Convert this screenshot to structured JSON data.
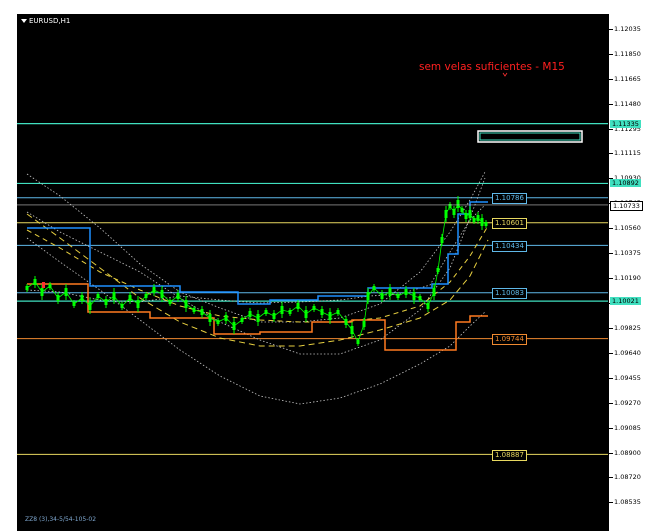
{
  "chart_window": {
    "title": "EURUSD,H1",
    "warning": "sem velas suficientes - M15",
    "indicator_label": "ZZ8 (3),34-5/54-105-02"
  },
  "price_scale": {
    "labels": [
      "1.12035",
      "1.11850",
      "1.11665",
      "1.11480",
      "1.11295",
      "1.11115",
      "1.10930",
      "1.10745",
      "1.10560",
      "1.10375",
      "1.10190",
      "1.10005",
      "1.09825",
      "1.09640",
      "1.09455",
      "1.09270",
      "1.09085",
      "1.08900",
      "1.08720",
      "1.08535"
    ],
    "current_price": "1.10733",
    "tags": [
      {
        "value": "1.11335",
        "color": "#40e0c0"
      },
      {
        "value": "1.10892",
        "color": "#40e0c0"
      },
      {
        "value": "1.10021",
        "color": "#40e0c0"
      }
    ]
  },
  "levels": [
    {
      "value": "1.10786",
      "color": "#5fb8e8"
    },
    {
      "value": "1.10601",
      "color": "#e8d860"
    },
    {
      "value": "1.10434",
      "color": "#5fb8e8"
    },
    {
      "value": "1.10083",
      "color": "#5fb8e8"
    },
    {
      "value": "1.09744",
      "color": "#f08a30"
    },
    {
      "value": "1.08887",
      "color": "#e8d860"
    }
  ],
  "colors": {
    "background": "#000000",
    "candles": "#00ff00",
    "aqua_lines": "#40e0c0",
    "blue_channel": "#1e90ff",
    "orange_channel": "#ff7a20",
    "yellow_dashes": "#e8d040",
    "white_dots": "#c8c8c8",
    "warning_text": "#ff2020"
  }
}
